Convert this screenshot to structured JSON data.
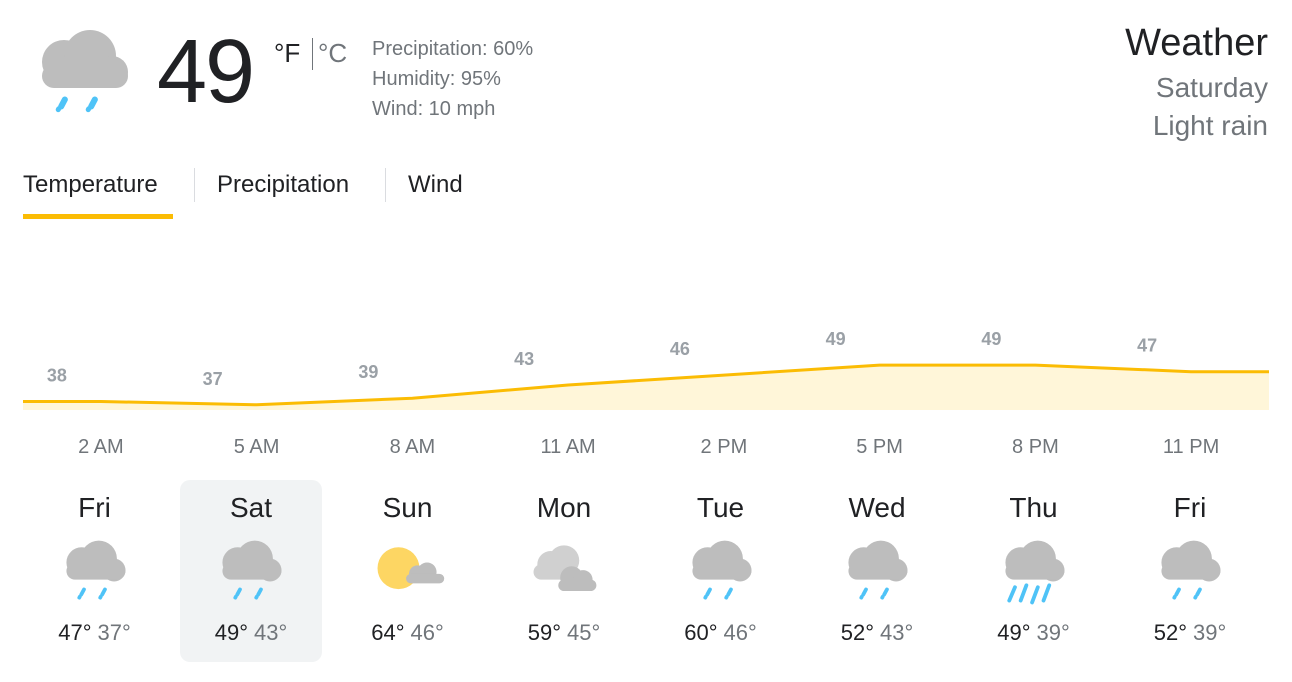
{
  "current": {
    "temperature": "49",
    "unit_f": "°F",
    "unit_c": "°C",
    "icon": "rain-cloud-icon",
    "precipitation": "Precipitation: 60%",
    "humidity": "Humidity: 95%",
    "wind": "Wind: 10 mph"
  },
  "header": {
    "title": "Weather",
    "day": "Saturday",
    "condition": "Light rain"
  },
  "tabs": [
    {
      "label": "Temperature",
      "active": true
    },
    {
      "label": "Precipitation",
      "active": false
    },
    {
      "label": "Wind",
      "active": false
    }
  ],
  "colors": {
    "accent": "#fbbc04",
    "chart_fill": "#fff6d9",
    "rain": "#4fc3f7",
    "cloud": "#bdbdbd",
    "sun": "#fdd663"
  },
  "chart_data": {
    "type": "area",
    "x": [
      "2 AM",
      "5 AM",
      "8 AM",
      "11 AM",
      "2 PM",
      "5 PM",
      "8 PM",
      "11 PM"
    ],
    "x_display": [
      "2 AM",
      "5 AM",
      "8 AM",
      "11 AM",
      "2 PM",
      "5 PM",
      "8 PM",
      "11 PM"
    ],
    "values": [
      38,
      37,
      39,
      43,
      46,
      49,
      49,
      47
    ],
    "label_values": [
      "38",
      "37",
      "39",
      "43",
      "46",
      "49",
      "49",
      "47"
    ],
    "ylim": [
      30,
      52
    ],
    "grid": false
  },
  "days": [
    {
      "name": "Fri",
      "high": "47°",
      "low": "37°",
      "icon": "rain-icon",
      "selected": false
    },
    {
      "name": "Sat",
      "high": "49°",
      "low": "43°",
      "icon": "rain-icon",
      "selected": true
    },
    {
      "name": "Sun",
      "high": "64°",
      "low": "46°",
      "icon": "partly-sunny-icon",
      "selected": false
    },
    {
      "name": "Mon",
      "high": "59°",
      "low": "45°",
      "icon": "cloudy-icon",
      "selected": false
    },
    {
      "name": "Tue",
      "high": "60°",
      "low": "46°",
      "icon": "rain-icon",
      "selected": false
    },
    {
      "name": "Wed",
      "high": "52°",
      "low": "43°",
      "icon": "rain-icon",
      "selected": false
    },
    {
      "name": "Thu",
      "high": "49°",
      "low": "39°",
      "icon": "heavy-rain-icon",
      "selected": false
    },
    {
      "name": "Fri",
      "high": "52°",
      "low": "39°",
      "icon": "rain-icon",
      "selected": false
    }
  ]
}
